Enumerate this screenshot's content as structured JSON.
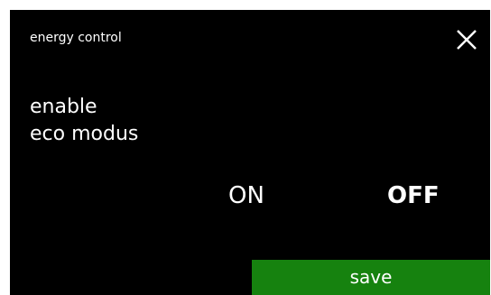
{
  "header": {
    "title": "energy control",
    "close_icon": "close-icon"
  },
  "setting": {
    "line1": "enable",
    "line2": "eco modus"
  },
  "options": {
    "on_label": "ON",
    "off_label": "OFF",
    "selected": "OFF"
  },
  "footer": {
    "save_label": "save"
  },
  "colors": {
    "background": "#000000",
    "text": "#ffffff",
    "save_button": "#16820f"
  }
}
